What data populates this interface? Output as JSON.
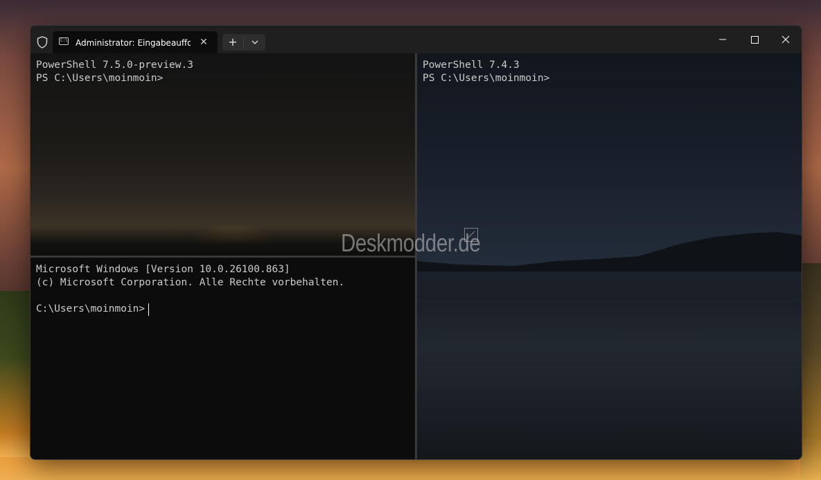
{
  "window": {
    "tab_title": "Administrator: Eingabeaufforderung",
    "tab_icon_text": "C:\\",
    "new_tab_symbol": "+",
    "close_tab_symbol": "✕"
  },
  "panes": {
    "top_left": {
      "lines": [
        "PowerShell 7.5.0-preview.3",
        "PS C:\\Users\\moinmoin>"
      ]
    },
    "right": {
      "lines": [
        "PowerShell 7.4.3",
        "PS C:\\Users\\moinmoin>"
      ]
    },
    "bottom_left": {
      "lines": [
        "Microsoft Windows [Version 10.0.26100.863]",
        "(c) Microsoft Corporation. Alle Rechte vorbehalten.",
        "",
        "C:\\Users\\moinmoin>"
      ]
    }
  },
  "watermark": {
    "text": "Deskmodder.de"
  },
  "colors": {
    "terminal_bg": "#0c0c0c",
    "terminal_text": "#cccccc",
    "titlebar_bg": "#1f1f1f"
  },
  "icons": {
    "shield": "shield-icon",
    "terminal": "cmd-icon",
    "dropdown": "chevron-down-icon",
    "minimize": "minimize-icon",
    "maximize": "maximize-icon",
    "close": "close-icon"
  }
}
